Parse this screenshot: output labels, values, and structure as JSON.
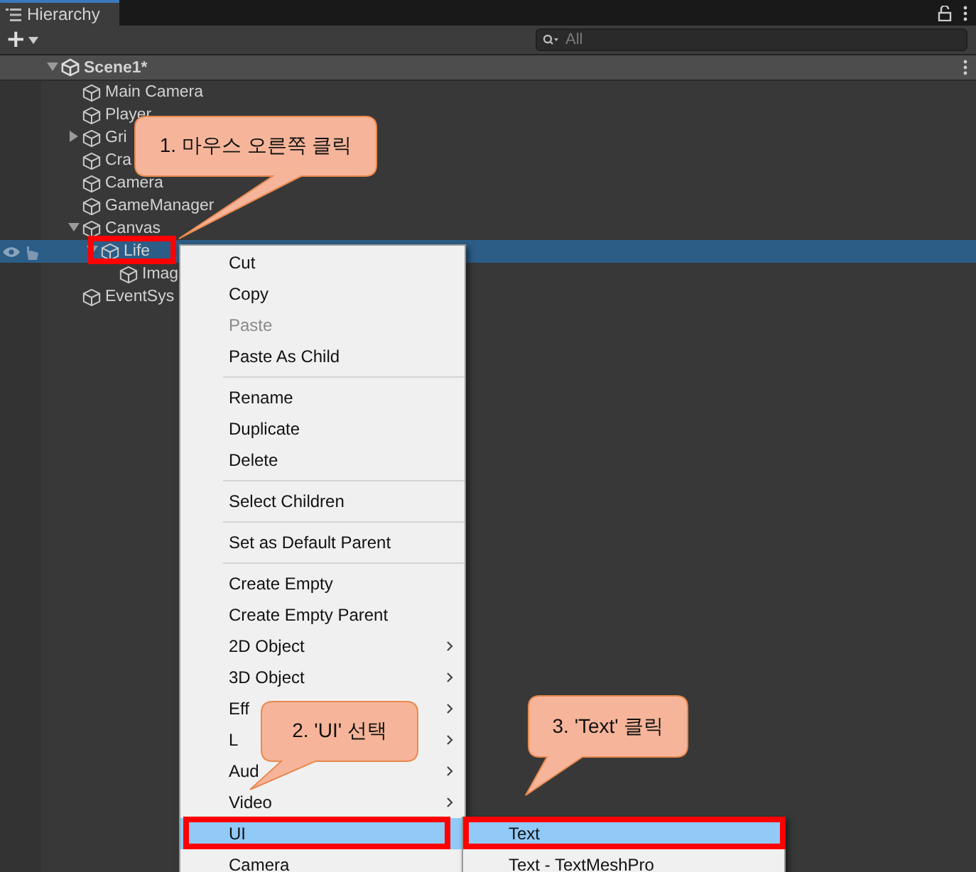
{
  "tab": {
    "label": "Hierarchy",
    "selected": true
  },
  "toolbar": {
    "add": "+",
    "search": {
      "placeholder": "All"
    }
  },
  "scene": {
    "label": "Scene1*",
    "expanded": true
  },
  "tree": [
    {
      "label": "Main Camera"
    },
    {
      "label": "Player"
    },
    {
      "label": "Gri",
      "expanded": false
    },
    {
      "label": "Cra"
    },
    {
      "label": "Camera"
    },
    {
      "label": "GameManager"
    },
    {
      "label": "Canvas",
      "expanded": true,
      "children": [
        {
          "label": "Life",
          "selected": true,
          "expanded": true,
          "children": [
            {
              "label": "Imag"
            }
          ]
        }
      ]
    },
    {
      "label": "EventSys"
    }
  ],
  "context_menu": {
    "items": [
      {
        "kind": "item",
        "label": "Cut"
      },
      {
        "kind": "item",
        "label": "Copy"
      },
      {
        "kind": "item",
        "label": "Paste",
        "disabled": true
      },
      {
        "kind": "item",
        "label": "Paste As Child"
      },
      {
        "kind": "separator"
      },
      {
        "kind": "item",
        "label": "Rename"
      },
      {
        "kind": "item",
        "label": "Duplicate"
      },
      {
        "kind": "item",
        "label": "Delete"
      },
      {
        "kind": "separator"
      },
      {
        "kind": "item",
        "label": "Select Children"
      },
      {
        "kind": "separator"
      },
      {
        "kind": "item",
        "label": "Set as Default Parent"
      },
      {
        "kind": "separator"
      },
      {
        "kind": "item",
        "label": "Create Empty"
      },
      {
        "kind": "item",
        "label": "Create Empty Parent"
      },
      {
        "kind": "item",
        "label": "2D Object",
        "submenu": true
      },
      {
        "kind": "item",
        "label": "3D Object",
        "submenu": true
      },
      {
        "kind": "item",
        "label": "Eff",
        "submenu": true
      },
      {
        "kind": "item",
        "label": "L",
        "submenu": true
      },
      {
        "kind": "item",
        "label": "Aud",
        "submenu": true
      },
      {
        "kind": "item",
        "label": "Video",
        "submenu": true
      },
      {
        "kind": "item",
        "label": "UI",
        "selected": true
      },
      {
        "kind": "item",
        "label": "Camera"
      }
    ]
  },
  "submenu": {
    "items": [
      {
        "label": "Text",
        "selected": true
      },
      {
        "label": "Text - TextMeshPro",
        "selected": false
      }
    ]
  },
  "callouts": [
    {
      "text": "1. 마우스 오른쪽 클릭"
    },
    {
      "text": "2. 'UI' 선택"
    },
    {
      "text": "3. 'Text' 클릭"
    }
  ]
}
